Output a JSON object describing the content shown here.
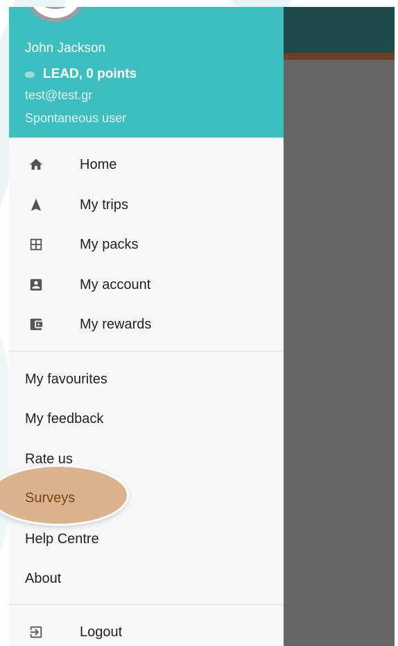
{
  "header": {
    "user_name": "John Jackson",
    "rank": "LEAD, 0 points",
    "email": "test@test.gr",
    "user_type": "Spontaneous user"
  },
  "menu_primary": [
    {
      "label": "Home",
      "icon": "home-icon"
    },
    {
      "label": "My trips",
      "icon": "navigation-arrow-icon"
    },
    {
      "label": "My packs",
      "icon": "grid-icon"
    },
    {
      "label": "My account",
      "icon": "account-box-icon"
    },
    {
      "label": "My rewards",
      "icon": "wallet-icon"
    }
  ],
  "menu_secondary": [
    {
      "label": "My favourites"
    },
    {
      "label": "My feedback"
    },
    {
      "label": "Rate us"
    },
    {
      "label": "Surveys"
    },
    {
      "label": "Help Centre"
    },
    {
      "label": "About"
    }
  ],
  "logout": {
    "label": "Logout",
    "icon": "logout-icon"
  },
  "colors": {
    "header_bg": "#3ebfbf",
    "highlight": "#dcb38f",
    "topbar": "#1c4a4a",
    "scrim": "#666666"
  }
}
